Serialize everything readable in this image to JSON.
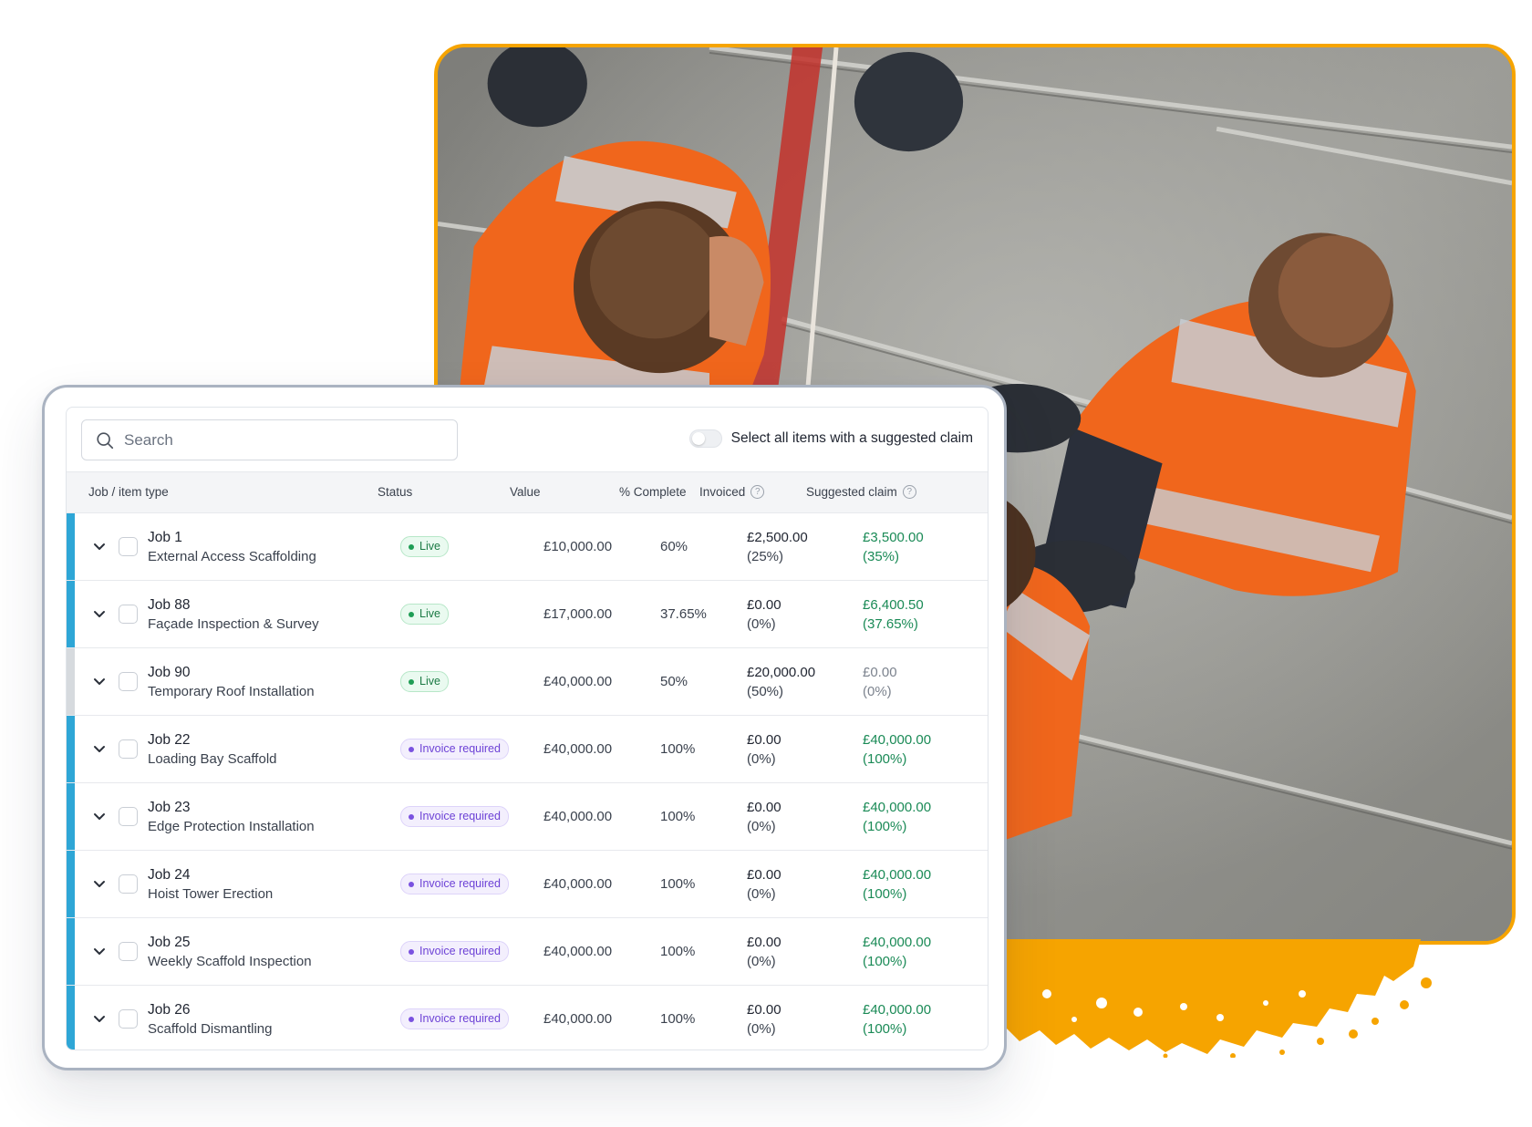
{
  "search": {
    "placeholder": "Search"
  },
  "select_all": {
    "label": "Select all items with a suggested claim",
    "enabled": false
  },
  "columns": {
    "job": "Job / item type",
    "status": "Status",
    "value": "Value",
    "complete": "% Complete",
    "invoiced": "Invoiced",
    "suggested": "Suggested claim"
  },
  "colors": {
    "accent_bar": "#2ea6d6",
    "photo_border": "#f6a400",
    "suggested_green": "#1a8a56",
    "live_green": "#1b7a44",
    "invoice_purple": "#6d42d6"
  },
  "rows": [
    {
      "job": "Job 1",
      "type": "External Access Scaffolding",
      "status": "Live",
      "status_kind": "live",
      "value": "£10,000.00",
      "complete": "60%",
      "invoiced": "£2,500.00",
      "invoiced_pct": "(25%)",
      "suggested": "£3,500.00",
      "suggested_pct": "(35%)",
      "bar": "active"
    },
    {
      "job": "Job 88",
      "type": "Façade Inspection & Survey",
      "status": "Live",
      "status_kind": "live",
      "value": "£17,000.00",
      "complete": "37.65%",
      "invoiced": "£0.00",
      "invoiced_pct": "(0%)",
      "suggested": "£6,400.50",
      "suggested_pct": "(37.65%)",
      "bar": "active"
    },
    {
      "job": "Job 90",
      "type": "Temporary Roof Installation",
      "status": "Live",
      "status_kind": "live",
      "value": "£40,000.00",
      "complete": "50%",
      "invoiced": "£20,000.00",
      "invoiced_pct": "(50%)",
      "suggested": "£0.00",
      "suggested_pct": "(0%)",
      "bar": "muted"
    },
    {
      "job": "Job 22",
      "type": "Loading Bay Scaffold",
      "status": "Invoice required",
      "status_kind": "inv",
      "value": "£40,000.00",
      "complete": "100%",
      "invoiced": "£0.00",
      "invoiced_pct": "(0%)",
      "suggested": "£40,000.00",
      "suggested_pct": "(100%)",
      "bar": "active"
    },
    {
      "job": "Job 23",
      "type": "Edge Protection Installation",
      "status": "Invoice required",
      "status_kind": "inv",
      "value": "£40,000.00",
      "complete": "100%",
      "invoiced": "£0.00",
      "invoiced_pct": "(0%)",
      "suggested": "£40,000.00",
      "suggested_pct": "(100%)",
      "bar": "active"
    },
    {
      "job": "Job 24",
      "type": "Hoist Tower Erection",
      "status": "Invoice required",
      "status_kind": "inv",
      "value": "£40,000.00",
      "complete": "100%",
      "invoiced": "£0.00",
      "invoiced_pct": "(0%)",
      "suggested": "£40,000.00",
      "suggested_pct": "(100%)",
      "bar": "active"
    },
    {
      "job": "Job 25",
      "type": "Weekly Scaffold Inspection",
      "status": "Invoice required",
      "status_kind": "inv",
      "value": "£40,000.00",
      "complete": "100%",
      "invoiced": "£0.00",
      "invoiced_pct": "(0%)",
      "suggested": "£40,000.00",
      "suggested_pct": "(100%)",
      "bar": "active"
    },
    {
      "job": "Job 26",
      "type": "Scaffold Dismantling",
      "status": "Invoice required",
      "status_kind": "inv",
      "value": "£40,000.00",
      "complete": "100%",
      "invoiced": "£0.00",
      "invoiced_pct": "(0%)",
      "suggested": "£40,000.00",
      "suggested_pct": "(100%)",
      "bar": "active"
    }
  ]
}
